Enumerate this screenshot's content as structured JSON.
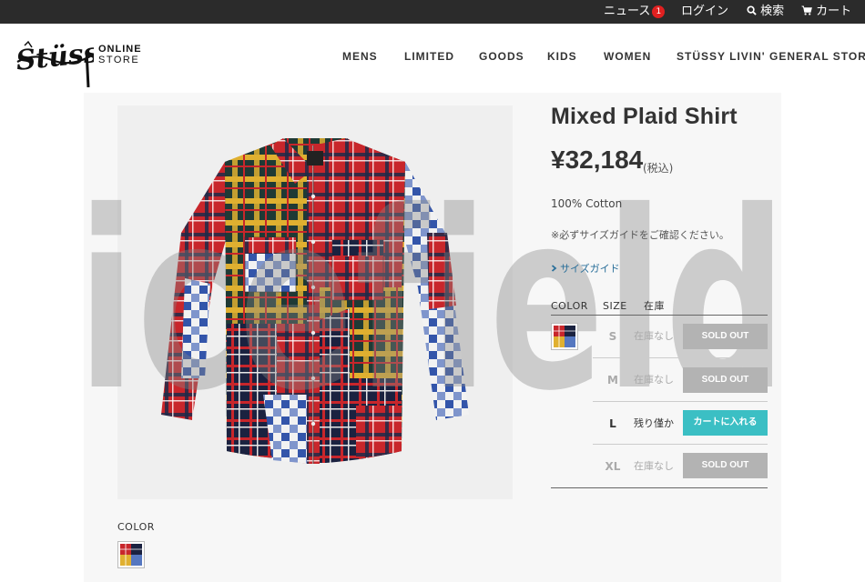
{
  "topbar": {
    "news_label": "ニュース",
    "news_count": "1",
    "login_label": "ログイン",
    "search_label": "検索",
    "cart_label": "カート"
  },
  "header": {
    "logo_text": "Stüssy",
    "logo_online": "ONLINE",
    "logo_store": "STORE",
    "nav": [
      "MENS",
      "LIMITED",
      "GOODS",
      "KIDS",
      "WOMEN",
      "STÜSSY LIVIN' GENERAL STORE"
    ]
  },
  "watermark": "icefield",
  "product": {
    "title": "Mixed Plaid Shirt",
    "price": "¥32,184",
    "tax_note": "(税込)",
    "material": "100% Cotton",
    "size_notice": "※必ずサイズガイドをご確認ください。",
    "size_guide_label": "サイズガイド",
    "table_headers": {
      "color": "COLOR",
      "size": "SIZE",
      "stock": "在庫"
    },
    "sizes": [
      {
        "size": "S",
        "stock": "在庫なし",
        "button": "SOLD OUT",
        "available": false
      },
      {
        "size": "M",
        "stock": "在庫なし",
        "button": "SOLD OUT",
        "available": false
      },
      {
        "size": "L",
        "stock": "残り僅か",
        "button": "カートに入れる",
        "available": true
      },
      {
        "size": "XL",
        "stock": "在庫なし",
        "button": "SOLD OUT",
        "available": false
      }
    ],
    "color_label": "COLOR"
  },
  "colors": {
    "topbar_bg": "#2b2b2b",
    "badge": "#e02020",
    "cart_button": "#3bbfc4",
    "sold_out_button": "#b3b3b3",
    "link": "#2a6f9a"
  }
}
